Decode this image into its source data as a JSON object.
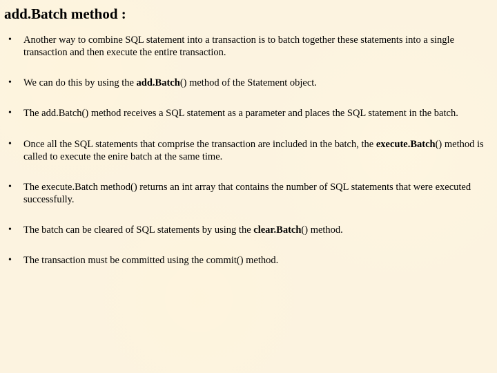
{
  "title": "add.Batch method :",
  "bullets": [
    {
      "pre": "Another way to combine SQL statement into a transaction is to batch together these statements into a single transaction and then execute the entire transaction.",
      "bold": "",
      "post": ""
    },
    {
      "pre": "We can do this by using the ",
      "bold": "add.Batch",
      "post": "() method of the Statement object."
    },
    {
      "pre": "The add.Batch() method receives a SQL statement as a parameter and places the SQL statement in the batch.",
      "bold": "",
      "post": ""
    },
    {
      "pre": "Once  all the SQL statements that comprise the transaction are included in the batch, the ",
      "bold": "execute.Batch",
      "post": "() method is called to execute the enire batch at the same time."
    },
    {
      "pre": " The execute.Batch method() returns an int array that contains the number of SQL  statements that were executed successfully.",
      "bold": "",
      "post": ""
    },
    {
      "pre": "The batch can be cleared of SQL statements by using the ",
      "bold": "clear.Batch",
      "post": "() method."
    },
    {
      "pre": "The transaction must be committed using the commit() method.",
      "bold": "",
      "post": ""
    }
  ]
}
